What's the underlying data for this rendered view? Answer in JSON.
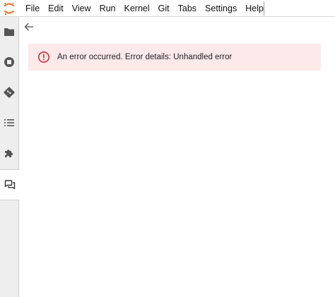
{
  "menubar": {
    "logo": "jupyter-logo",
    "items": [
      "File",
      "Edit",
      "View",
      "Run",
      "Kernel",
      "Git",
      "Tabs",
      "Settings",
      "Help"
    ]
  },
  "sidebar": {
    "buttons": [
      {
        "icon": "folder-icon"
      },
      {
        "icon": "stop-circle-icon"
      },
      {
        "icon": "git-icon"
      },
      {
        "icon": "list-icon"
      },
      {
        "icon": "extension-puzzle-icon"
      },
      {
        "icon": "chat-icon",
        "active": true
      }
    ]
  },
  "main": {
    "back_icon": "arrow-left-icon",
    "error": {
      "icon": "error-circle-icon",
      "message": "An error occurred. Error details: Unhandled error",
      "accent_color": "#d32f2f",
      "background_color": "#fde9ea"
    }
  }
}
